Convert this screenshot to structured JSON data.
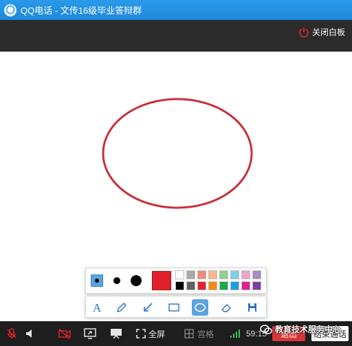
{
  "window": {
    "title": "QQ电话 - 文传16级毕业答辩群",
    "logo_icon": "qq-penguin-icon"
  },
  "whiteboard": {
    "close_label": "关闭白板",
    "close_icon": "power-icon",
    "shape": {
      "type": "ellipse",
      "stroke_color": "#c8303a"
    }
  },
  "pen_toolbar": {
    "sizes": [
      "small",
      "medium",
      "large"
    ],
    "selected_size": "small",
    "current_color": "#e0212b",
    "palette_top": [
      "#ffffff",
      "#a8a8a8",
      "#f08a7a",
      "#f6b98c",
      "#8fd18f",
      "#7fd0e8",
      "#f2a3c8",
      "#a98bc5"
    ],
    "palette_bottom": [
      "#000000",
      "#606060",
      "#e0212b",
      "#f38b14",
      "#1aa84a",
      "#1a9fe0",
      "#e11f8f",
      "#7a3fa6"
    ]
  },
  "tool_toolbar": {
    "tools": [
      "text-icon",
      "pencil-icon",
      "arrow-icon",
      "rectangle-icon",
      "ellipse-icon",
      "eraser-icon",
      "save-icon"
    ],
    "active_tool": "ellipse-icon"
  },
  "callbar": {
    "fullscreen_label": "全屏",
    "grid_label": "宫格",
    "timer": "59:15",
    "exit_label": "退出",
    "end_call_label": "结束通话",
    "watermark": "教育技术服务中心"
  }
}
